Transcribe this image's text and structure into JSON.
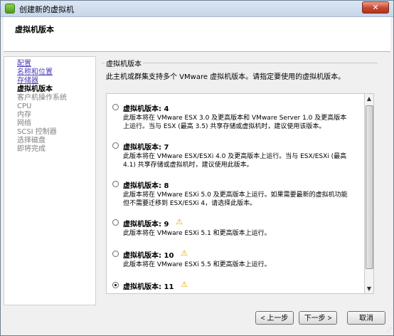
{
  "window": {
    "title": "创建新的虚拟机",
    "close_label": "✕"
  },
  "header": {
    "title": "虚拟机版本"
  },
  "nav": {
    "items": [
      {
        "label": "配置",
        "state": "link"
      },
      {
        "label": "名称和位置",
        "state": "link"
      },
      {
        "label": "存储器",
        "state": "link"
      },
      {
        "label": "虚拟机版本",
        "state": "current"
      },
      {
        "label": "客户机操作系统",
        "state": "disabled"
      },
      {
        "label": "CPU",
        "state": "disabled"
      },
      {
        "label": "内存",
        "state": "disabled"
      },
      {
        "label": "网络",
        "state": "disabled"
      },
      {
        "label": "SCSI 控制器",
        "state": "disabled"
      },
      {
        "label": "选择磁盘",
        "state": "disabled"
      },
      {
        "label": "即将完成",
        "state": "disabled"
      }
    ]
  },
  "main": {
    "group_title": "虚拟机版本",
    "description": "此主机或群集支持多个 VMware 虚拟机版本。请指定要使用的虚拟机版本。",
    "options": [
      {
        "label": "虚拟机版本: 4",
        "warning": false,
        "selected": false,
        "desc": "此版本将在 VMware ESX 3.0 及更高版本和 VMware Server 1.0 及更高版本上运行。当与 ESX (最高 3.5) 共享存储或虚拟机时，建议使用该版本。"
      },
      {
        "label": "虚拟机版本: 7",
        "warning": false,
        "selected": false,
        "desc": "此版本将在 VMware ESX/ESXi 4.0 及更高版本上运行。当与 ESX/ESXi (最高 4.1) 共享存储或虚拟机时，建议使用此版本。"
      },
      {
        "label": "虚拟机版本: 8",
        "warning": false,
        "selected": false,
        "desc": "此版本将在 VMware ESXi 5.0 及更高版本上运行。如果需要最新的虚拟机功能但不需要迁移到 ESX/ESXi 4，请选择此版本。"
      },
      {
        "label": "虚拟机版本: 9",
        "warning": true,
        "selected": false,
        "desc": "此版本将在 VMware ESXi 5.1 和更高版本上运行。"
      },
      {
        "label": "虚拟机版本: 10",
        "warning": true,
        "selected": false,
        "desc": "此版本将在 VMware ESXi 5.5 和更高版本上运行。"
      },
      {
        "label": "虚拟机版本: 11",
        "warning": true,
        "selected": true,
        "desc": ""
      }
    ]
  },
  "footer": {
    "back_label": "< 上一步",
    "next_label": "下一步 >",
    "cancel_label": "取消"
  },
  "icons": {
    "warning": "warning-icon",
    "app": "vm-app-icon",
    "close": "close-icon"
  },
  "colors": {
    "link": "#4b3fb5",
    "warning": "#e0a800",
    "close": "#c8452e"
  }
}
